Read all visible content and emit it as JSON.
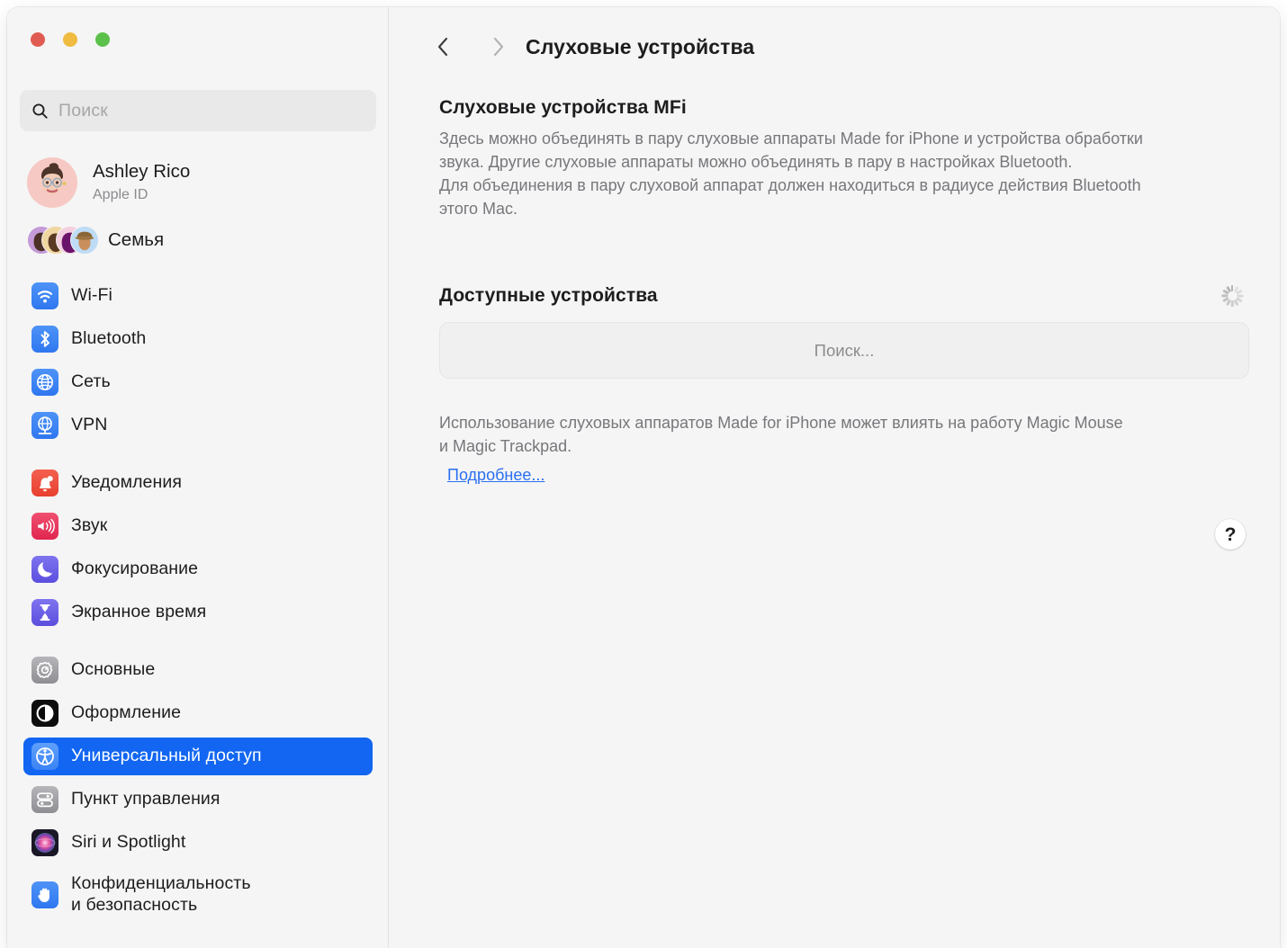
{
  "window": {
    "traffic_lights": [
      {
        "name": "close",
        "color": "#e05c52"
      },
      {
        "name": "minimize",
        "color": "#efbb40"
      },
      {
        "name": "zoom",
        "color": "#5bc14a"
      }
    ]
  },
  "sidebar": {
    "search": {
      "placeholder": "Поиск",
      "value": "",
      "icon": "search-icon"
    },
    "account": {
      "name": "Ashley Rico",
      "subtitle": "Apple ID",
      "avatar": "memoji-avatar"
    },
    "family": {
      "label": "Семья",
      "icon": "family-avatars"
    },
    "groups": [
      {
        "items": [
          {
            "label": "Wi-Fi",
            "icon": "wifi-icon",
            "selected": false
          },
          {
            "label": "Bluetooth",
            "icon": "bluetooth-icon",
            "selected": false
          },
          {
            "label": "Сеть",
            "icon": "network-globe-icon",
            "selected": false
          },
          {
            "label": "VPN",
            "icon": "vpn-globe-icon",
            "selected": false
          }
        ]
      },
      {
        "items": [
          {
            "label": "Уведомления",
            "icon": "notifications-bell-icon",
            "selected": false
          },
          {
            "label": "Звук",
            "icon": "sound-speaker-icon",
            "selected": false
          },
          {
            "label": "Фокусирование",
            "icon": "focus-moon-icon",
            "selected": false
          },
          {
            "label": "Экранное время",
            "icon": "screen-time-hourglass-icon",
            "selected": false
          }
        ]
      },
      {
        "items": [
          {
            "label": "Основные",
            "icon": "general-gear-icon",
            "selected": false
          },
          {
            "label": "Оформление",
            "icon": "appearance-contrast-icon",
            "selected": false
          },
          {
            "label": "Универсальный доступ",
            "icon": "accessibility-icon",
            "selected": true
          },
          {
            "label": "Пункт управления",
            "icon": "control-center-toggles-icon",
            "selected": false
          },
          {
            "label": "Siri и Spotlight",
            "icon": "siri-icon",
            "selected": false
          },
          {
            "label": "Конфиденциальность\nи безопасность",
            "label_line1": "Конфиденциальность",
            "label_line2": "и безопасность",
            "icon": "privacy-hand-icon",
            "selected": false
          }
        ]
      }
    ]
  },
  "main": {
    "nav": {
      "back_icon": "chevron-left-icon",
      "forward_icon": "chevron-right-icon"
    },
    "title": "Слуховые устройства",
    "section": {
      "heading": "Слуховые устройства MFi",
      "body_line1": "Здесь можно объединять в пару слуховые аппараты Made for iPhone и устройства обработки",
      "body_line2": "звука. Другие слуховые аппараты можно объединять в пару в настройках Bluetooth.",
      "body_line3": "Для объединения в пару слуховой аппарат должен находиться в радиусе действия Bluetooth",
      "body_line4": "этого Mac."
    },
    "available": {
      "heading": "Доступные устройства",
      "spinner_icon": "activity-spinner-icon",
      "status": "Поиск..."
    },
    "footer": {
      "note_line1": "Использование слуховых аппаратов Made for iPhone может влиять на работу Magic Mouse",
      "note_line2": "и Magic Trackpad.",
      "link": "Подробнее..."
    },
    "help_button": {
      "glyph": "?",
      "icon": "help-question-icon"
    }
  },
  "colors": {
    "accent": "#1266f1",
    "link": "#2b6ff0",
    "background": "#f5f5f5",
    "text_primary": "#1d1d1f",
    "text_secondary": "#77777c"
  }
}
